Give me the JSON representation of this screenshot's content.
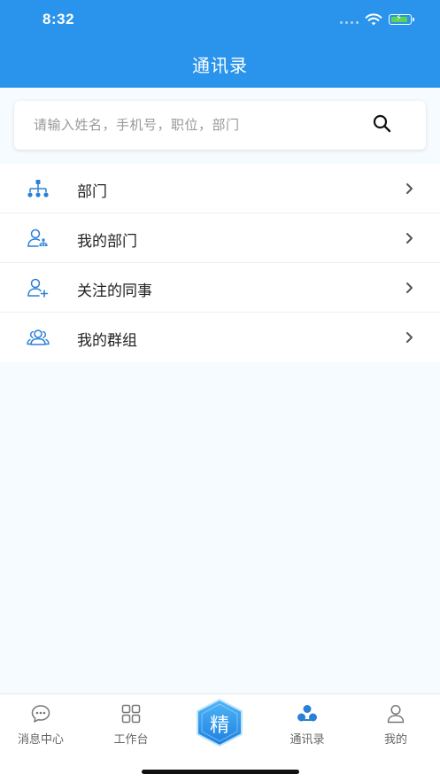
{
  "status_bar": {
    "time": "8:32"
  },
  "header": {
    "title": "通讯录"
  },
  "search": {
    "placeholder": "请输入姓名，手机号，职位，部门",
    "icon": "search-icon"
  },
  "list": {
    "items": [
      {
        "label": "部门",
        "icon": "org-chart-icon"
      },
      {
        "label": "我的部门",
        "icon": "user-department-icon"
      },
      {
        "label": "关注的同事",
        "icon": "add-user-icon"
      },
      {
        "label": "我的群组",
        "icon": "group-icon"
      }
    ]
  },
  "tabbar": {
    "tabs": [
      {
        "label": "消息中心",
        "icon": "chat-bubble-icon",
        "active": false
      },
      {
        "label": "工作台",
        "icon": "grid-icon",
        "active": false
      },
      {
        "label": "精",
        "icon": "center-hexagon-icon",
        "active": false
      },
      {
        "label": "通讯录",
        "icon": "contacts-icon",
        "active": true
      },
      {
        "label": "我的",
        "icon": "person-icon",
        "active": false
      }
    ]
  },
  "colors": {
    "primary": "#2a94ec",
    "background": "#f5fbfe",
    "active_tab": "#2a94ec",
    "inactive_tab": "#666666"
  }
}
